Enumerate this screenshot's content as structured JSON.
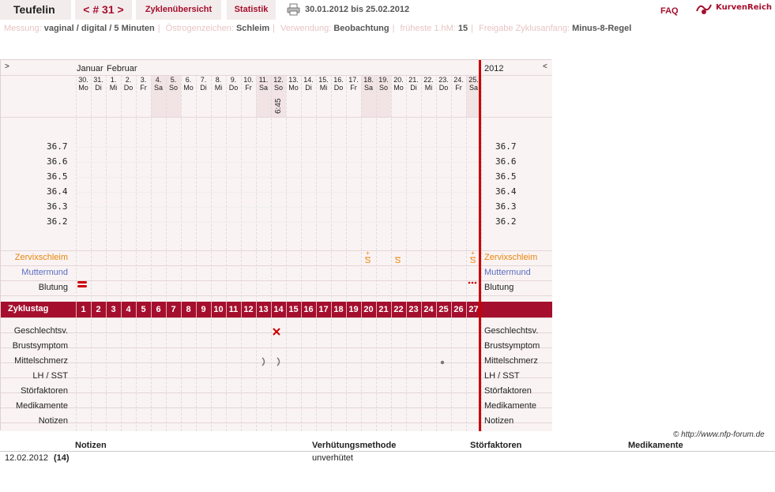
{
  "header": {
    "title": "Teufelin",
    "cycle": "< # 31 >",
    "tabs": [
      "Zyklenübersicht",
      "Statistik"
    ],
    "date_range": "30.01.2012 bis 25.02.2012",
    "faq": "FAQ",
    "logo": "KurvenReich"
  },
  "info": [
    {
      "label": "Messung:",
      "value": "vaginal / digital / 5 Minuten"
    },
    {
      "label": "Östrogenzeichen:",
      "value": "Schleim"
    },
    {
      "label": "Verwendung:",
      "value": "Beobachtung"
    },
    {
      "label": "früheste 1.hM:",
      "value": "15"
    },
    {
      "label": "Freigabe Zyklusanfang:",
      "value": "Minus-8-Regel"
    }
  ],
  "chart": {
    "nav_left": ">",
    "nav_right": "<",
    "year": "2012",
    "months": [
      "Januar",
      "Februar"
    ],
    "days": [
      {
        "d": "30.",
        "w": "Mo"
      },
      {
        "d": "31.",
        "w": "Di"
      },
      {
        "d": "1.",
        "w": "Mi"
      },
      {
        "d": "2.",
        "w": "Do"
      },
      {
        "d": "3.",
        "w": "Fr"
      },
      {
        "d": "4.",
        "w": "Sa"
      },
      {
        "d": "5.",
        "w": "So"
      },
      {
        "d": "6.",
        "w": "Mo"
      },
      {
        "d": "7.",
        "w": "Di"
      },
      {
        "d": "8.",
        "w": "Mi"
      },
      {
        "d": "9.",
        "w": "Do"
      },
      {
        "d": "10.",
        "w": "Fr"
      },
      {
        "d": "11.",
        "w": "Sa"
      },
      {
        "d": "12.",
        "w": "So"
      },
      {
        "d": "13.",
        "w": "Mo"
      },
      {
        "d": "14.",
        "w": "Di"
      },
      {
        "d": "15.",
        "w": "Mi"
      },
      {
        "d": "16.",
        "w": "Do"
      },
      {
        "d": "17.",
        "w": "Fr"
      },
      {
        "d": "18.",
        "w": "Sa"
      },
      {
        "d": "19.",
        "w": "So"
      },
      {
        "d": "20.",
        "w": "Mo"
      },
      {
        "d": "21.",
        "w": "Di"
      },
      {
        "d": "22.",
        "w": "Mi"
      },
      {
        "d": "23.",
        "w": "Do"
      },
      {
        "d": "24.",
        "w": "Fr"
      },
      {
        "d": "25.",
        "w": "Sa"
      }
    ],
    "time_label": "6:45",
    "temps": [
      "36.7",
      "36.6",
      "36.5",
      "36.4",
      "36.3",
      "36.2"
    ],
    "rows_top": [
      {
        "label": "Zervixschleim",
        "color": "#e8850c"
      },
      {
        "label": "Muttermund",
        "color": "#5b6fc0"
      },
      {
        "label": "Blutung",
        "color": "#222222"
      }
    ],
    "zyklustag_label": "Zyklustag",
    "cycle_days": [
      "1",
      "2",
      "3",
      "4",
      "5",
      "6",
      "7",
      "8",
      "9",
      "10",
      "11",
      "12",
      "13",
      "14",
      "15",
      "16",
      "17",
      "18",
      "19",
      "20",
      "21",
      "22",
      "23",
      "24",
      "25",
      "26",
      "27"
    ],
    "rows_bottom": [
      "Geschlechtsv.",
      "Brustsymptom",
      "Mittelschmerz",
      "LH / SST",
      "Störfaktoren",
      "Medikamente",
      "Notizen"
    ],
    "accent_color": "#a50f2d"
  },
  "footer": {
    "copyright": "© http://www.nfp-forum.de",
    "columns": [
      "Notizen",
      "Verhütungsmethode",
      "Störfaktoren",
      "Medikamente"
    ],
    "entry": {
      "date": "12.02.2012",
      "day": "(14)",
      "method": "unverhütet"
    }
  }
}
